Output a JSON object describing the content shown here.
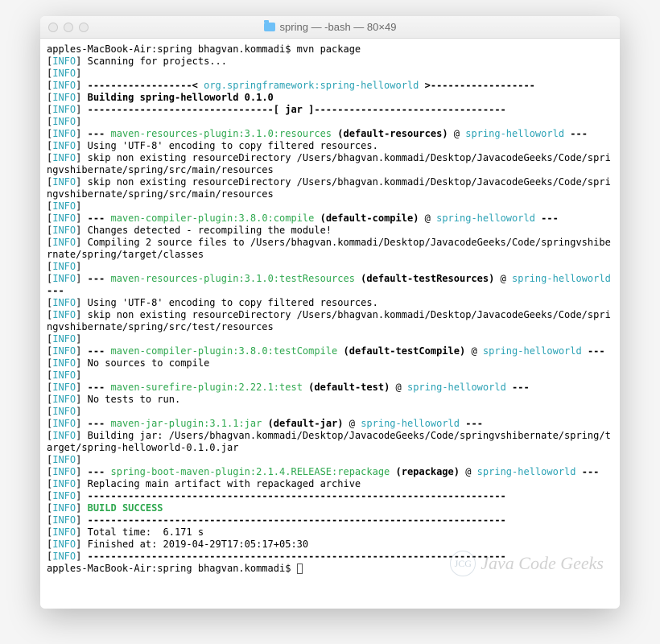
{
  "window": {
    "title": "spring — -bash — 80×49"
  },
  "prompt": {
    "host_path": "apples-MacBook-Air:spring bhagvan.kommadi$ ",
    "command": "mvn package",
    "final_prompt": "apples-MacBook-Air:spring bhagvan.kommadi$ "
  },
  "lines": {
    "l01": "Scanning for projects...",
    "l03_dashes_pre": "------------------< ",
    "l03_artifact": "org.springframework:spring-helloworld",
    "l03_dashes_post": " >------------------",
    "l04_build": "Building spring-helloworld 0.1.0",
    "l05_jar": "--------------------------------[ jar ]---------------------------------",
    "l07_dashes": "--- ",
    "l07_plugin": "maven-resources-plugin:3.1.0:resources",
    "l07_goal": " (default-resources)",
    "l07_at": " @ ",
    "l07_proj": "spring-helloworld",
    "l07_end": " ---",
    "l08": "Using 'UTF-8' encoding to copy filtered resources.",
    "l09": "skip non existing resourceDirectory /Users/bhagvan.kommadi/Desktop/JavacodeGeeks/Code/springvshibernate/spring/src/main/resources",
    "l10": "skip non existing resourceDirectory /Users/bhagvan.kommadi/Desktop/JavacodeGeeks/Code/springvshibernate/spring/src/main/resources",
    "l12_plugin": "maven-compiler-plugin:3.8.0:compile",
    "l12_goal": " (default-compile)",
    "l12_proj": "spring-helloworld",
    "l13": "Changes detected - recompiling the module!",
    "l14": "Compiling 2 source files to /Users/bhagvan.kommadi/Desktop/JavacodeGeeks/Code/springvshibernate/spring/target/classes",
    "l16_plugin": "maven-resources-plugin:3.1.0:testResources",
    "l16_goal": " (default-testResources)",
    "l16_proj": "spring-helloworld",
    "l17": "Using 'UTF-8' encoding to copy filtered resources.",
    "l18": "skip non existing resourceDirectory /Users/bhagvan.kommadi/Desktop/JavacodeGeeks/Code/springvshibernate/spring/src/test/resources",
    "l20_plugin": "maven-compiler-plugin:3.8.0:testCompile",
    "l20_goal": " (default-testCompile)",
    "l20_proj": "spring-helloworld",
    "l21": "No sources to compile",
    "l23_plugin": "maven-surefire-plugin:2.22.1:test",
    "l23_goal": " (default-test)",
    "l23_proj": "spring-helloworld",
    "l24": "No tests to run.",
    "l26_plugin": "maven-jar-plugin:3.1.1:jar",
    "l26_goal": " (default-jar)",
    "l26_proj": "spring-helloworld",
    "l27": "Building jar: /Users/bhagvan.kommadi/Desktop/JavacodeGeeks/Code/springvshibernate/spring/target/spring-helloworld-0.1.0.jar",
    "l29_plugin": "spring-boot-maven-plugin:2.1.4.RELEASE:repackage",
    "l29_goal": " (repackage)",
    "l29_proj": "spring-helloworld",
    "l30": "Replacing main artifact with repackaged archive",
    "sep": "------------------------------------------------------------------------",
    "success": "BUILD SUCCESS",
    "total": "Total time:  6.171 s",
    "finished": "Finished at: 2019-04-29T17:05:17+05:30"
  },
  "labels": {
    "info_open": "[",
    "info": "INFO",
    "info_close": "] "
  },
  "watermark": {
    "abbr": "JCG",
    "text": "Java Code Geeks"
  }
}
